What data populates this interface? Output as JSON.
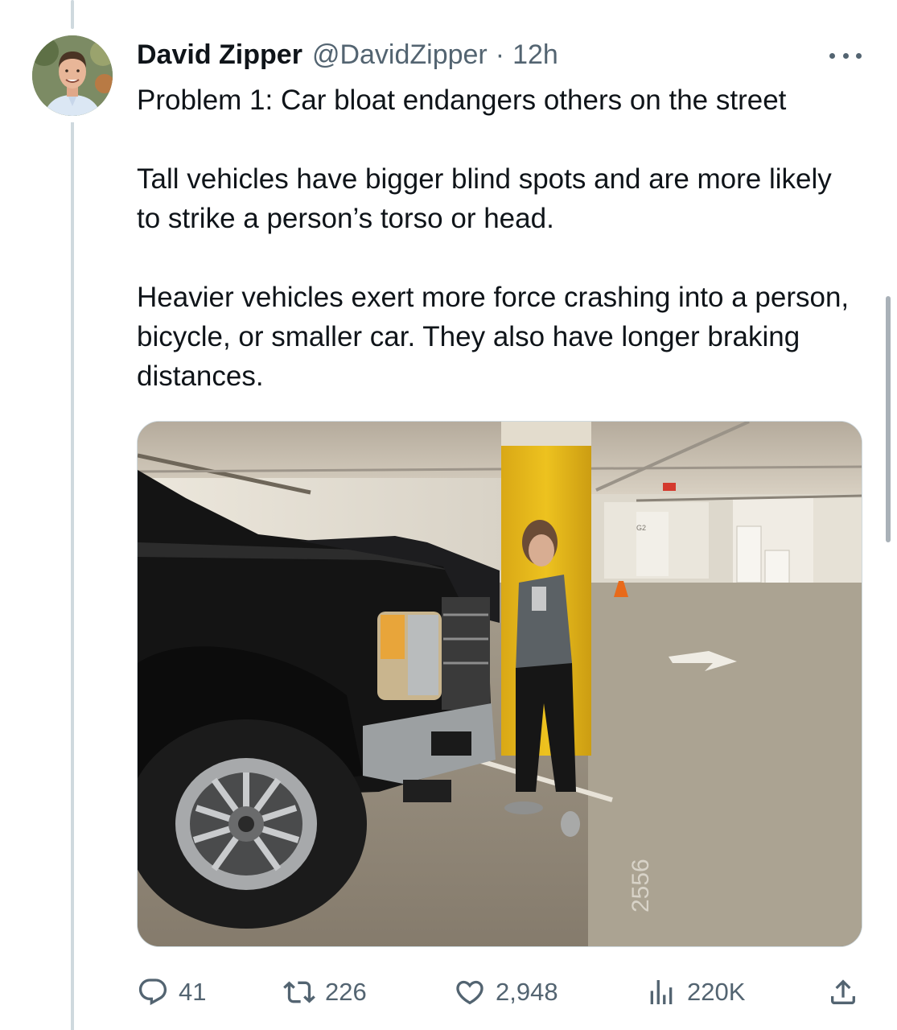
{
  "tweet": {
    "author": {
      "display_name": "David Zipper",
      "handle": "@DavidZipper",
      "separator": "·",
      "time": "12h"
    },
    "paragraphs": [
      "Problem 1: Car bloat endangers others on the street",
      "Tall vehicles have bigger blind spots and are more likely to strike a person’s torso or head.",
      "Heavier vehicles exert more force crashing into a person, bicycle, or smaller car. They also have longer braking distances."
    ],
    "media": {
      "type": "photo",
      "visible_text": [
        "G2",
        "2556"
      ]
    },
    "actions": {
      "replies": "41",
      "reposts": "226",
      "likes": "2,948",
      "views": "220K"
    }
  },
  "icons": {
    "more": "more-horizontal-icon",
    "reply": "reply-icon",
    "repost": "repost-icon",
    "like": "heart-icon",
    "views": "views-chart-icon",
    "share": "share-icon"
  },
  "colors": {
    "text_primary": "#0f1419",
    "text_secondary": "#536471",
    "border": "#cfd9de"
  }
}
